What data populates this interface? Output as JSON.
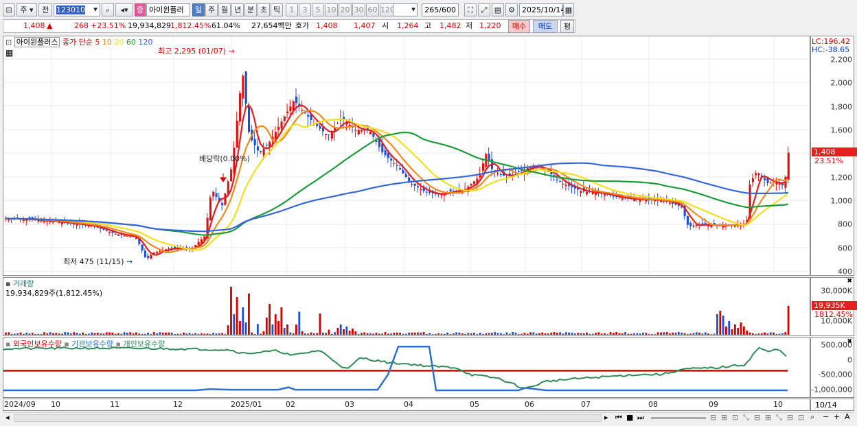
{
  "toolbar": {
    "period_label": "주",
    "prev_label": "전",
    "code_value": "123010",
    "stock_badge": "증",
    "stock_name": "아이윈플러",
    "period_tabs": [
      "일",
      "주",
      "월",
      "년",
      "분",
      "초",
      "틱"
    ],
    "interval_tabs": [
      "1",
      "3",
      "5",
      "10",
      "20",
      "30",
      "60",
      "120"
    ],
    "count_value": "265",
    "count_max": "/600",
    "date_value": "2025/10/14"
  },
  "quote": {
    "price": "1,408",
    "arrow": "▲",
    "change": "268",
    "change_pct": "+23.51%",
    "volume": "19,934,829",
    "volume_pct": "1,812.45%",
    "turnover_pct": "61.04%",
    "trade_value": "27,654백만",
    "ask_label": "호가",
    "ask": "1,408",
    "bid": "1,407",
    "open_label": "시",
    "open": "1,264",
    "high_label": "고",
    "high": "1,482",
    "low_label": "저",
    "low": "1,220",
    "buy_label": "매수",
    "sell_label": "매도",
    "eval_label": "평"
  },
  "price_panel": {
    "title": "아이윈플러스",
    "legend_prefix": "종가 단순",
    "ma_periods": [
      "5",
      "10",
      "20",
      "60",
      "120"
    ],
    "ma_colors": [
      "#e51c1c",
      "#f08a1c",
      "#f0e020",
      "#1f9a3a",
      "#3566d8"
    ],
    "high_annotation": "최고 2,295 (01/07)",
    "low_annotation": "최저 475 (11/15)",
    "dividend_annotation": "배당락(0.00%)",
    "lc_label": "LC:196.42",
    "hc_label": "HC:-38.65",
    "y_ticks": [
      "2,200",
      "2,000",
      "1,800",
      "1,600",
      "1,400",
      "1,200",
      "1,000",
      "800",
      "600",
      "400"
    ],
    "current_price_tag": "1,408",
    "current_pct_tag": "23.51%"
  },
  "volume_panel": {
    "title": "거래량",
    "value_label": "19,934,829주(1,812.45%)",
    "y_ticks": [
      "30,000K",
      "20,000K",
      "10,000K"
    ],
    "current_tag": "19,935K",
    "current_pct_tag": "1812.45%"
  },
  "holding_panel": {
    "legend": [
      "외국인보유수량",
      "기관보유수량",
      "개인보유수량"
    ],
    "legend_colors": [
      "#d40000",
      "#2f6fd0",
      "#2e8b57"
    ],
    "y_ticks": [
      "500,000",
      "0",
      "-500,000",
      "-1,000,000"
    ]
  },
  "x_axis": {
    "labels": [
      "2024/09",
      "10",
      "11",
      "12",
      "2025/01",
      "02",
      "03",
      "04",
      "05",
      "06",
      "07",
      "08",
      "09",
      "10"
    ],
    "right_label": "10/14"
  },
  "chart_data": {
    "type": "candlestick",
    "x_range": [
      "2024/09",
      "2025/10/14"
    ],
    "y_range": [
      400,
      2300
    ],
    "close_series": [
      [
        "2024/09",
        850
      ],
      [
        "2024/10",
        820
      ],
      [
        "2024/10/20",
        760
      ],
      [
        "2024/11",
        700
      ],
      [
        "2024/11/15",
        480
      ],
      [
        "2024/11/25",
        610
      ],
      [
        "2024/12",
        580
      ],
      [
        "2024/12/15",
        660
      ],
      [
        "2024/12/25",
        1150
      ],
      [
        "2025/01/07",
        2100
      ],
      [
        "2025/01/15",
        1400
      ],
      [
        "2025/01/25",
        1600
      ],
      [
        "2025/02",
        1850
      ],
      [
        "2025/02/15",
        1700
      ],
      [
        "2025/03",
        1580
      ],
      [
        "2025/03/15",
        1550
      ],
      [
        "2025/04",
        1200
      ],
      [
        "2025/04/15",
        1050
      ],
      [
        "2025/05",
        1150
      ],
      [
        "2025/05/10",
        1350
      ],
      [
        "2025/05/25",
        1200
      ],
      [
        "2025/06",
        1300
      ],
      [
        "2025/06/15",
        1150
      ],
      [
        "2025/07",
        1050
      ],
      [
        "2025/07/15",
        1020
      ],
      [
        "2025/08",
        1000
      ],
      [
        "2025/08/15",
        780
      ],
      [
        "2025/09",
        790
      ],
      [
        "2025/09/15",
        1200
      ],
      [
        "2025/10",
        1150
      ],
      [
        "2025/10/14",
        1408
      ]
    ],
    "volume_peaks_k": [
      [
        "2025/01/07",
        29000
      ],
      [
        "2025/01/20",
        25000
      ],
      [
        "2025/09/20",
        12000
      ],
      [
        "2025/10/14",
        19935
      ]
    ],
    "holding_range": [
      -1000000,
      500000
    ]
  }
}
